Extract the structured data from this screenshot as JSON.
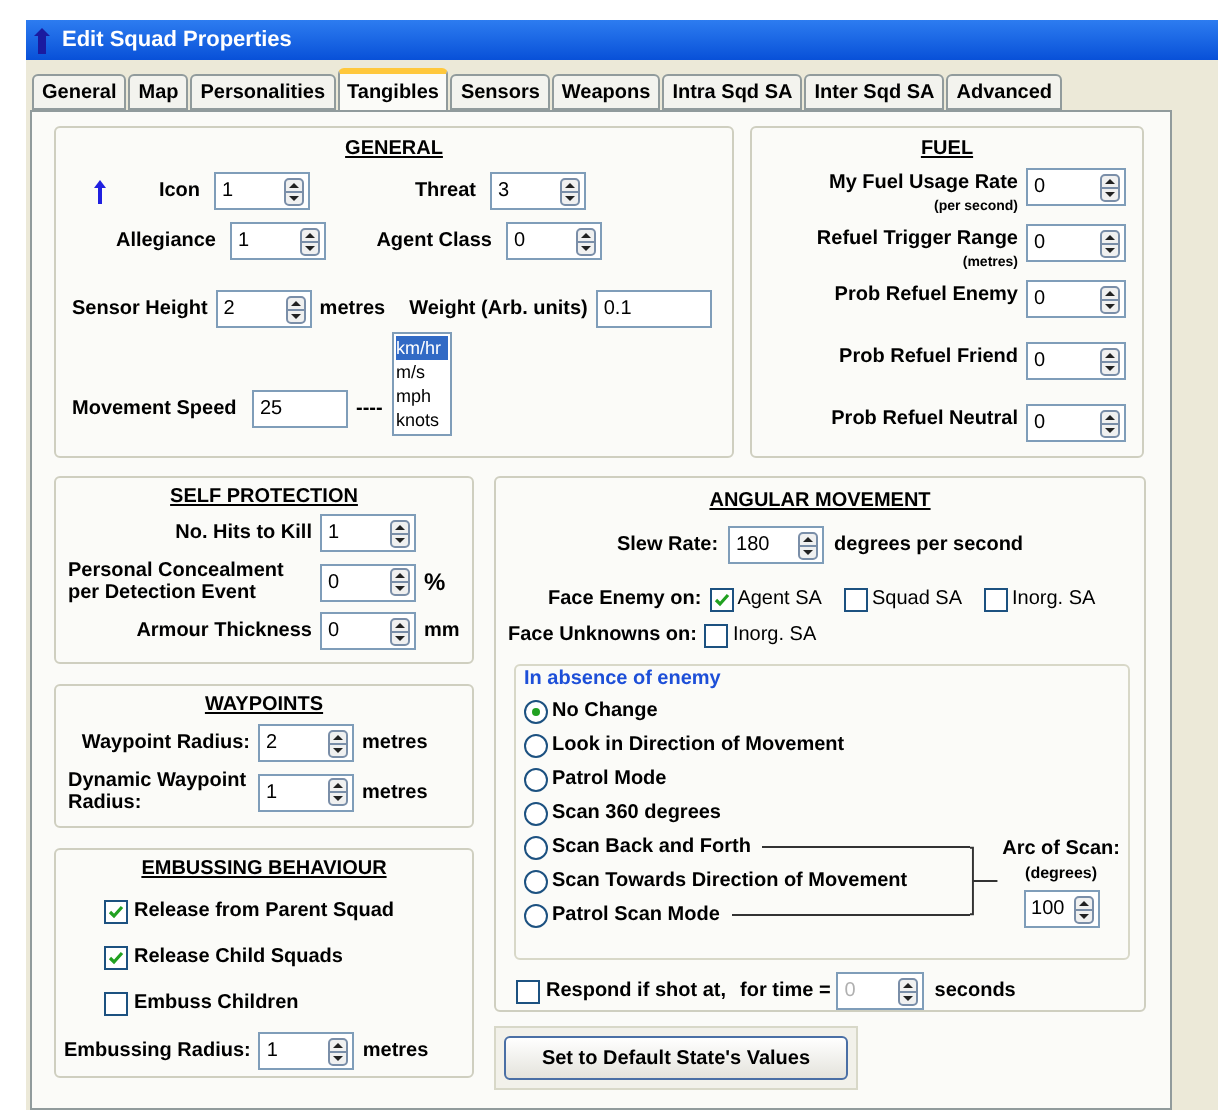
{
  "window": {
    "title": "Edit Squad Properties"
  },
  "tabs": [
    {
      "label": "General",
      "selected": false
    },
    {
      "label": "Map",
      "selected": false
    },
    {
      "label": "Personalities",
      "selected": false
    },
    {
      "label": "Tangibles",
      "selected": true
    },
    {
      "label": "Sensors",
      "selected": false
    },
    {
      "label": "Weapons",
      "selected": false
    },
    {
      "label": "Intra Sqd SA",
      "selected": false
    },
    {
      "label": "Inter Sqd SA",
      "selected": false
    },
    {
      "label": "Advanced",
      "selected": false
    }
  ],
  "general": {
    "heading": "GENERAL",
    "icon": {
      "label": "Icon",
      "value": "1"
    },
    "threat": {
      "label": "Threat",
      "value": "3"
    },
    "allegiance": {
      "label": "Allegiance",
      "value": "1"
    },
    "agent_class": {
      "label": "Agent Class",
      "value": "0"
    },
    "sensor_height": {
      "label": "Sensor Height",
      "value": "2",
      "unit": "metres"
    },
    "weight": {
      "label": "Weight (Arb. units)",
      "value": "0.1"
    },
    "movement_speed": {
      "label": "Movement Speed",
      "value": "25",
      "separator": "----",
      "units": [
        {
          "label": "km/hr",
          "selected": true
        },
        {
          "label": "m/s",
          "selected": false
        },
        {
          "label": "mph",
          "selected": false
        },
        {
          "label": "knots",
          "selected": false
        }
      ]
    }
  },
  "fuel": {
    "heading": "FUEL",
    "fields": [
      {
        "label": "My Fuel Usage Rate",
        "note": "(per second)",
        "value": "0"
      },
      {
        "label": "Refuel Trigger Range",
        "note": "(metres)",
        "value": "0"
      },
      {
        "label": "Prob Refuel Enemy",
        "value": "0"
      },
      {
        "label": "Prob Refuel Friend",
        "value": "0"
      },
      {
        "label": "Prob Refuel Neutral",
        "value": "0"
      }
    ]
  },
  "self_protection": {
    "heading": "SELF PROTECTION",
    "fields": [
      {
        "label": "No. Hits to Kill",
        "value": "1"
      },
      {
        "label": "Personal Concealment per Detection Event",
        "value": "0",
        "unit": "%"
      },
      {
        "label": "Armour Thickness",
        "value": "0",
        "unit": "mm"
      }
    ]
  },
  "waypoints": {
    "heading": "WAYPOINTS",
    "fields": [
      {
        "label": "Waypoint Radius:",
        "value": "2",
        "unit": "metres"
      },
      {
        "label": "Dynamic Waypoint Radius:",
        "value": "1",
        "unit": "metres"
      }
    ]
  },
  "embussing": {
    "heading": "EMBUSSING BEHAVIOUR",
    "options": [
      {
        "label": "Release from Parent Squad",
        "checked": true
      },
      {
        "label": "Release Child Squads",
        "checked": true
      },
      {
        "label": "Embuss Children",
        "checked": false
      }
    ],
    "radius": {
      "label": "Embussing Radius:",
      "value": "1",
      "unit": "metres"
    }
  },
  "angular": {
    "heading": "ANGULAR MOVEMENT",
    "slew_rate": {
      "label": "Slew Rate:",
      "value": "180",
      "unit": "degrees per second"
    },
    "face_enemy": {
      "label": "Face Enemy on:",
      "options": [
        {
          "label": "Agent SA",
          "checked": true
        },
        {
          "label": "Squad SA",
          "checked": false
        },
        {
          "label": "Inorg. SA",
          "checked": false
        }
      ]
    },
    "face_unknowns": {
      "label": "Face Unknowns on:",
      "options": [
        {
          "label": "Inorg. SA",
          "checked": false
        }
      ]
    },
    "absence": {
      "legend": "In absence of enemy",
      "options": [
        {
          "label": "No Change",
          "selected": true
        },
        {
          "label": "Look in Direction of Movement",
          "selected": false
        },
        {
          "label": "Patrol Mode",
          "selected": false
        },
        {
          "label": "Scan 360 degrees",
          "selected": false
        },
        {
          "label": "Scan Back and Forth",
          "selected": false
        },
        {
          "label": "Scan Towards Direction of Movement",
          "selected": false
        },
        {
          "label": "Patrol Scan Mode",
          "selected": false
        }
      ],
      "arc": {
        "label": "Arc of Scan:",
        "note": "(degrees)",
        "value": "100"
      }
    },
    "respond": {
      "label": "Respond if shot at,",
      "checked": false,
      "time_label": "for time =",
      "value": "0",
      "unit": "seconds"
    }
  },
  "default_button": "Set to Default State's Values"
}
